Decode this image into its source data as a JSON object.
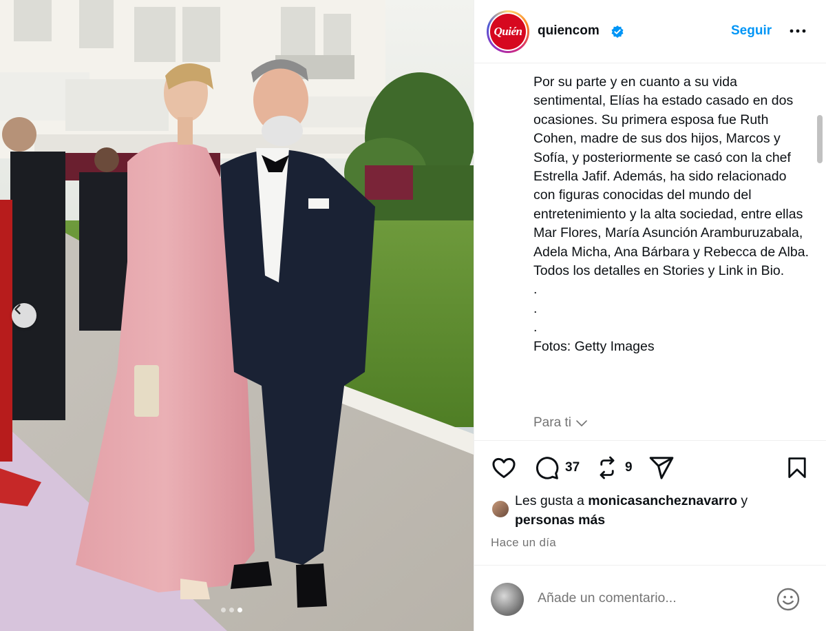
{
  "post": {
    "username": "quiencom",
    "brand_logo_text": "Quién",
    "follow_label": "Seguir",
    "more_icon": "more-horizontal-icon",
    "verified_icon": "verified-badge-icon",
    "caption": "Por su parte y en cuanto a su vida sentimental, Elías ha estado casado en dos ocasiones. Su primera esposa fue Ruth Cohen, madre de sus dos hijos, Marcos y Sofía, y posteriormente se casó con la chef Estrella Jafif. Además, ha sido relacionado con figuras conocidas del mundo del entretenimiento y la alta sociedad, entre ellas Mar Flores, María Asunción Aramburuzabala, Adela Micha, Ana Bárbara y Rebecca de Alba. Todos los detalles en Stories y Link in Bio.\n.\n.\n.\nFotos: Getty Images",
    "see_translation": "Para ti",
    "actions": {
      "comments_count": "37",
      "reposts_count": "9"
    },
    "likes": {
      "prefix": "Les gusta a ",
      "user": "monicasancheznavarro",
      "suffix": " y",
      "others": "personas más"
    },
    "time": "Hace un día",
    "comment_placeholder": "Añade un comentario...",
    "carousel": {
      "slides": 3,
      "active": 3
    }
  },
  "colors": {
    "accent": "#0095f6",
    "brand_red": "#d6081f",
    "muted": "#737373"
  }
}
